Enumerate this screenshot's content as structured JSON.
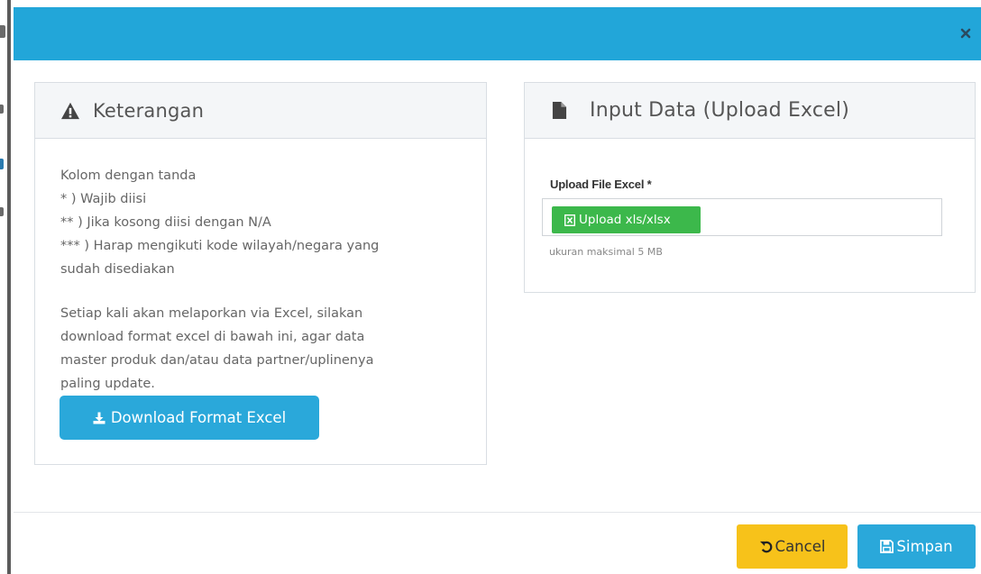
{
  "colors": {
    "header": "#22a6d9",
    "primary": "#2aa8da",
    "success": "#3cb84b",
    "warning": "#f7c21a"
  },
  "modal": {
    "close_icon": "close-icon"
  },
  "keterangan": {
    "title": "Keterangan",
    "icon": "warning-icon",
    "lines": [
      "Kolom dengan tanda",
      "* ) Wajib diisi",
      "** ) Jika kosong diisi dengan N/A",
      "*** ) Harap mengikuti kode wilayah/negara yang",
      "sudah disediakan"
    ],
    "paragraph_lines": [
      "Setiap kali akan melaporkan via Excel, silakan",
      "download format excel di bawah ini, agar data",
      "master produk dan/atau data partner/uplinenya",
      "paling update."
    ],
    "download_label": "Download Format Excel",
    "download_icon": "download-icon"
  },
  "input_data": {
    "title": "Input Data (Upload Excel)",
    "icon": "file-icon",
    "field_label": "Upload File Excel *",
    "upload_label": "Upload xls/xlsx",
    "upload_icon": "excel-file-icon",
    "hint": "ukuran maksimal 5 MB"
  },
  "footer": {
    "cancel_label": "Cancel",
    "cancel_icon": "undo-icon",
    "save_label": "Simpan",
    "save_icon": "save-icon"
  }
}
